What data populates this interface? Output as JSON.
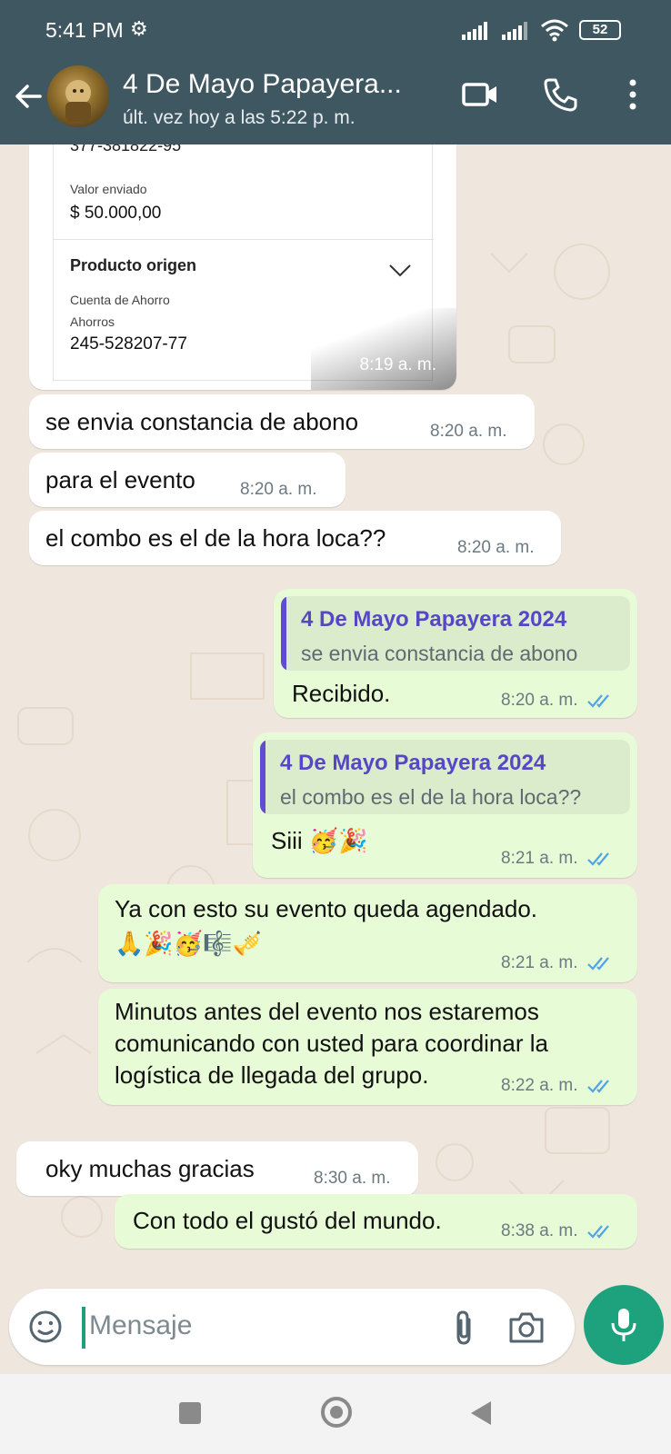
{
  "status_bar": {
    "time": "5:41 PM",
    "battery": "52"
  },
  "header": {
    "title": "4 De Mayo Papayera...",
    "subtitle": "últ. vez hoy a las 5:22 p. m."
  },
  "receipt": {
    "account_line": "377-381822-95",
    "amount_label": "Valor enviado",
    "amount_value": "$ 50.000,00",
    "product_title": "Producto origen",
    "account_type_label": "Cuenta de Ahorro",
    "account_type": "Ahorros",
    "account_number": "245-528207-77",
    "time": "8:19 a. m."
  },
  "messages": [
    {
      "direction": "in",
      "text": "se envia constancia de abono",
      "time": "8:20 a. m."
    },
    {
      "direction": "in",
      "text": "para el evento",
      "time": "8:20 a. m."
    },
    {
      "direction": "in",
      "text": "el combo es el de la hora loca??",
      "time": "8:20 a. m."
    },
    {
      "direction": "out",
      "quote_author": "4 De Mayo Papayera 2024",
      "quote_text": "se envia constancia de abono",
      "text": "Recibido.",
      "time": "8:20 a. m."
    },
    {
      "direction": "out",
      "quote_author": "4 De Mayo Papayera 2024",
      "quote_text": "el combo es el de la hora loca??",
      "text": "Siii 🥳🎉",
      "time": "8:21 a. m."
    },
    {
      "direction": "out",
      "text_line1": "Ya con esto su evento queda agendado.",
      "text_line2": "🙏🎉🥳🎼🎺",
      "time": "8:21 a. m."
    },
    {
      "direction": "out",
      "text_line1": "Minutos antes del evento nos estaremos",
      "text_line2": "comunicando con usted para coordinar la",
      "text_line3": "logística de llegada del grupo.",
      "time": "8:22 a. m."
    },
    {
      "direction": "in",
      "text": "oky muchas gracias",
      "time": "8:30 a. m."
    },
    {
      "direction": "out",
      "text": "Con todo el gustó del mundo.",
      "time": "8:38 a. m."
    }
  ],
  "composer": {
    "placeholder": "Mensaje"
  },
  "colors": {
    "header": "#3f5761",
    "outgoing": "#e7fbd6",
    "incoming": "#ffffff",
    "accent": "#1ea27d",
    "read_ticks": "#4fa3e8",
    "quote_bar": "#5f4bd6"
  }
}
